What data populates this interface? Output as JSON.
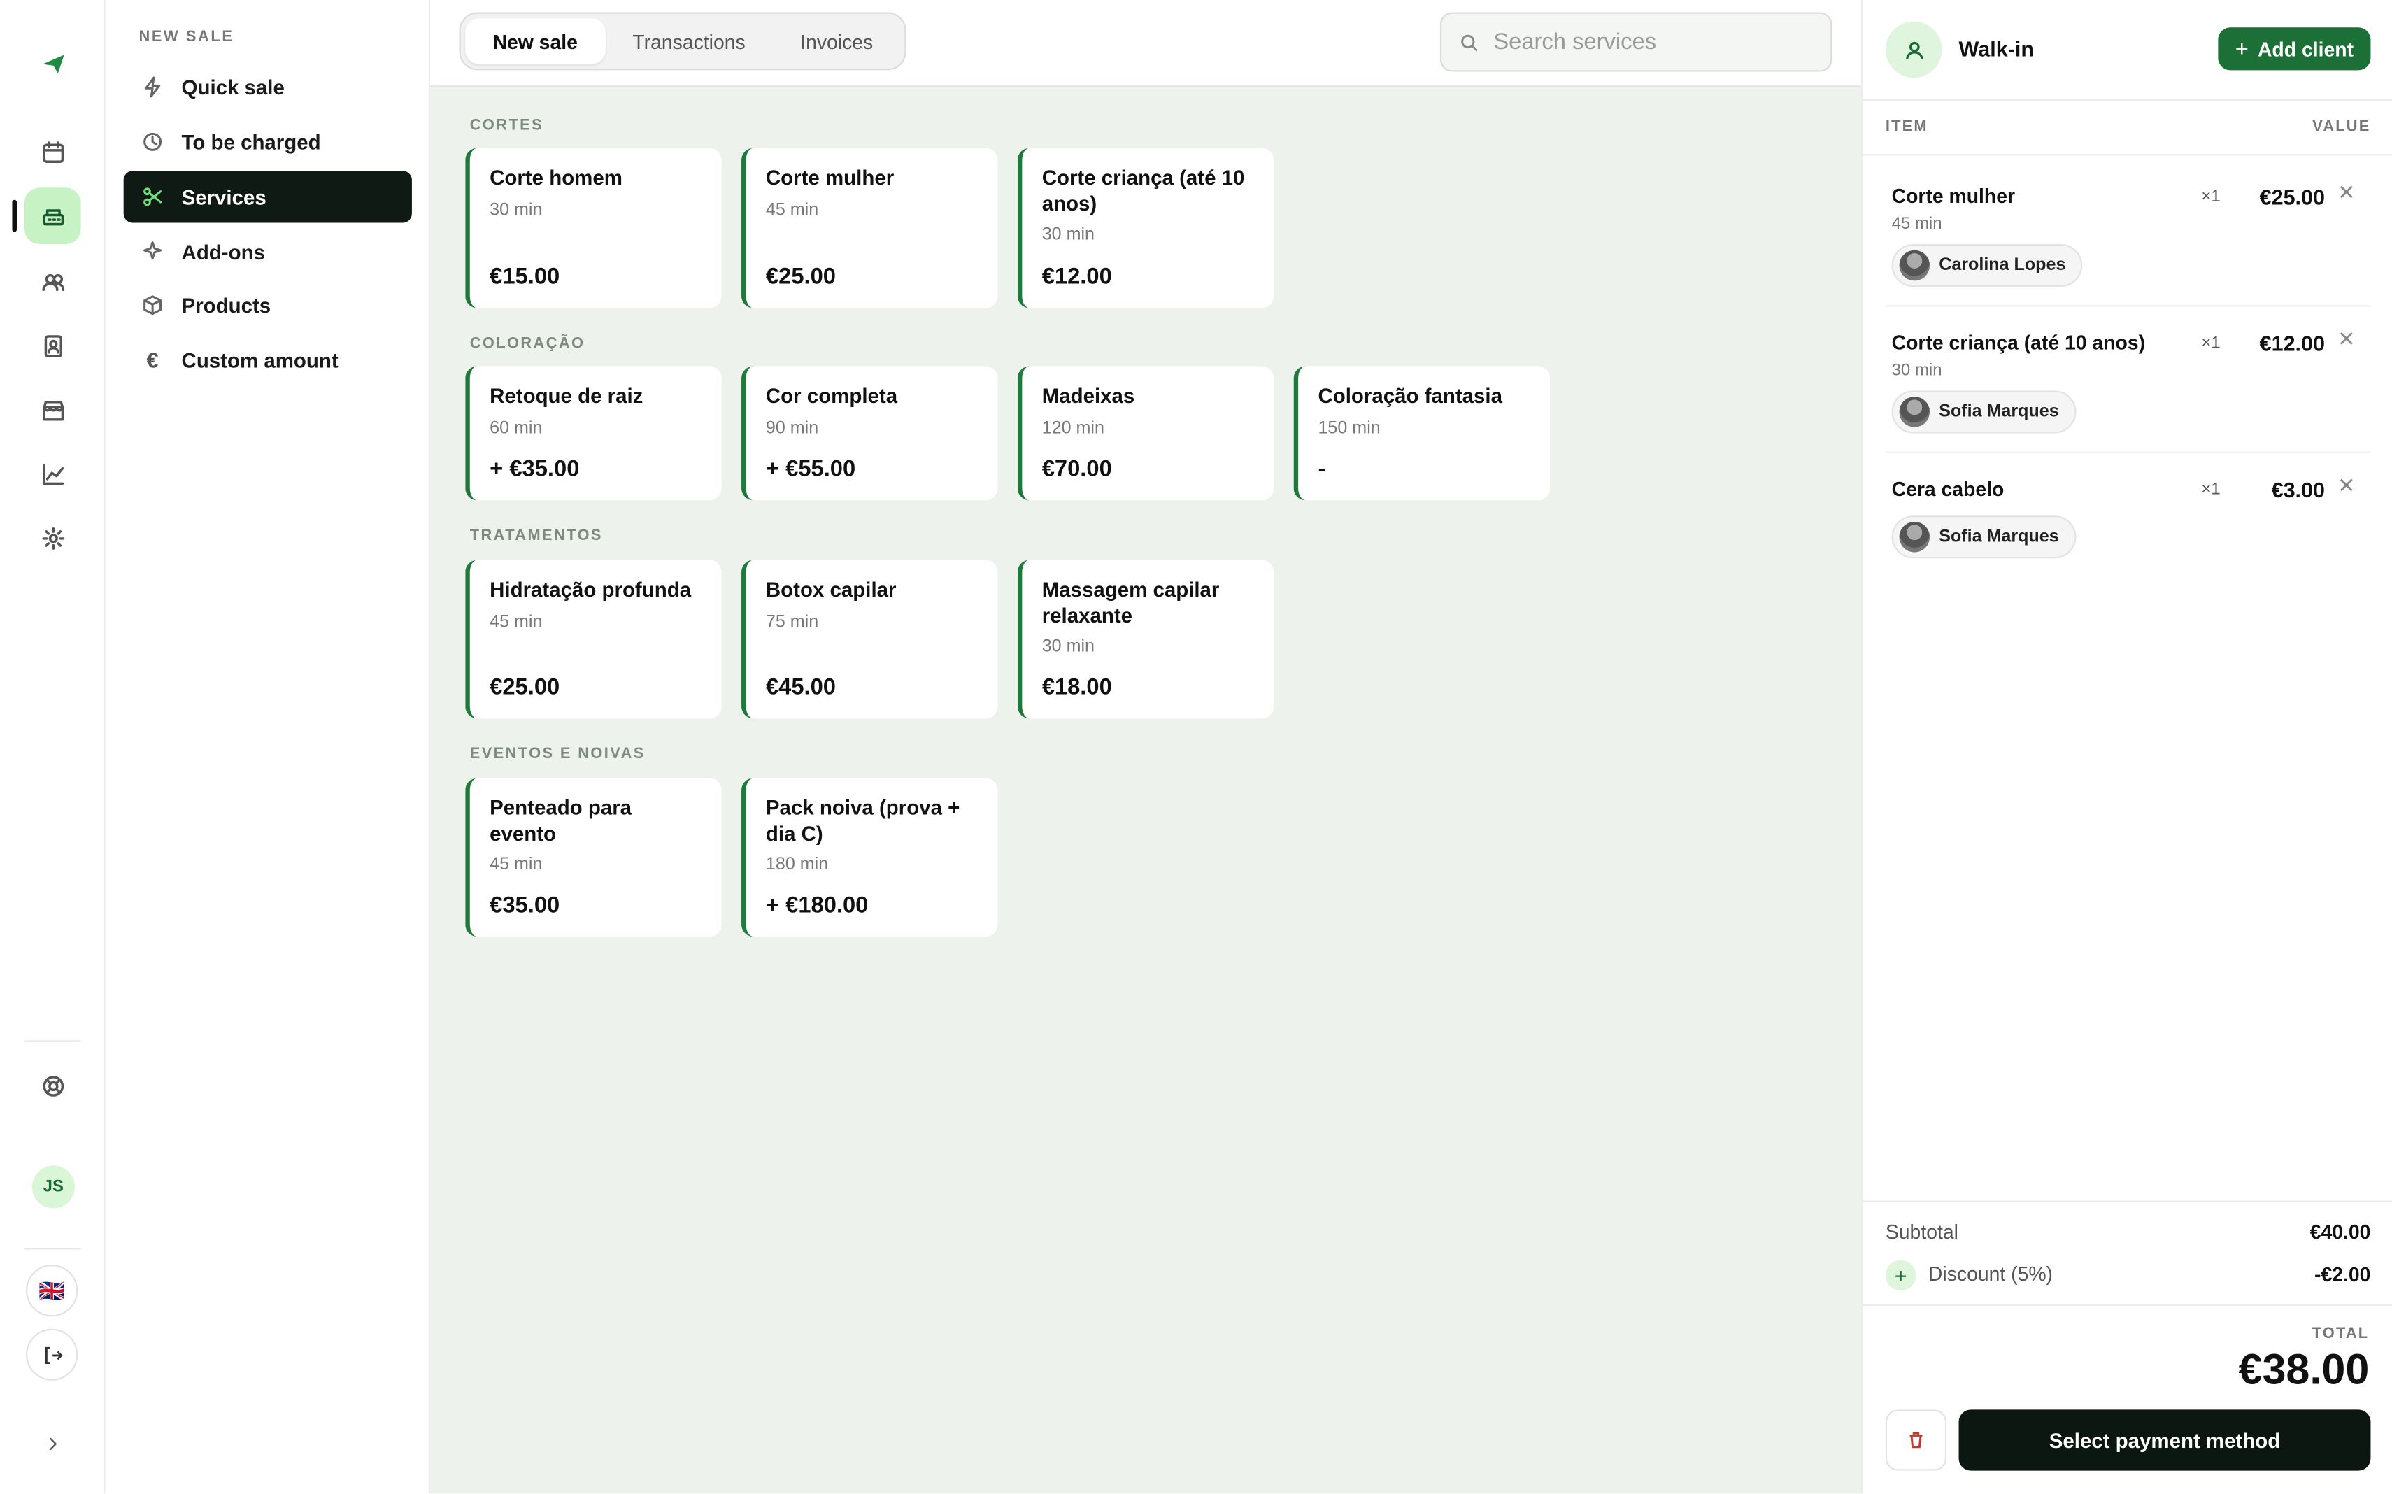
{
  "colors": {
    "accent": "#1d6f38",
    "accent_light": "#c6f2c4",
    "dark": "#0f1a14",
    "main_bg": "#edf3ec"
  },
  "rail": {
    "icons": [
      "logo-icon",
      "calendar-icon",
      "register-icon",
      "clients-icon",
      "staff-icon",
      "store-icon",
      "reports-icon",
      "settings-icon",
      "help-icon"
    ],
    "user_initials": "JS",
    "language_flag": "🇬🇧"
  },
  "submenu": {
    "heading": "NEW SALE",
    "items": [
      {
        "label": "Quick sale",
        "icon": "lightning-icon"
      },
      {
        "label": "To be charged",
        "icon": "clock-icon"
      },
      {
        "label": "Services",
        "icon": "scissors-icon"
      },
      {
        "label": "Add-ons",
        "icon": "sparkle-icon"
      },
      {
        "label": "Products",
        "icon": "box-icon"
      },
      {
        "label": "Custom amount",
        "icon": "euro-icon"
      }
    ],
    "active": "Services"
  },
  "topbar": {
    "tabs": [
      "New sale",
      "Transactions",
      "Invoices"
    ],
    "active_tab": "New sale",
    "search_placeholder": "Search services"
  },
  "sections": [
    {
      "title": "CORTES",
      "services": [
        {
          "name": "Corte homem",
          "duration": "30 min",
          "price": "€15.00"
        },
        {
          "name": "Corte mulher",
          "duration": "45 min",
          "price": "€25.00"
        },
        {
          "name": "Corte criança (até 10 anos)",
          "duration": "30 min",
          "price": "€12.00"
        }
      ]
    },
    {
      "title": "COLORAÇÃO",
      "services": [
        {
          "name": "Retoque de raiz",
          "duration": "60 min",
          "price": "+ €35.00"
        },
        {
          "name": "Cor completa",
          "duration": "90 min",
          "price": "+ €55.00"
        },
        {
          "name": "Madeixas",
          "duration": "120 min",
          "price": "€70.00"
        },
        {
          "name": "Coloração fantasia",
          "duration": "150 min",
          "price": "-"
        }
      ]
    },
    {
      "title": "TRATAMENTOS",
      "services": [
        {
          "name": "Hidratação profunda",
          "duration": "45 min",
          "price": "€25.00"
        },
        {
          "name": "Botox capilar",
          "duration": "75 min",
          "price": "€45.00"
        },
        {
          "name": "Massagem capilar relaxante",
          "duration": "30 min",
          "price": "€18.00"
        }
      ]
    },
    {
      "title": "EVENTOS E NOIVAS",
      "services": [
        {
          "name": "Penteado para evento",
          "duration": "45 min",
          "price": "€35.00"
        },
        {
          "name": "Pack noiva (prova + dia C)",
          "duration": "180 min",
          "price": "+ €180.00"
        }
      ]
    }
  ],
  "cart": {
    "client_name": "Walk-in",
    "add_client_label": "Add client",
    "col_item": "ITEM",
    "col_value": "VALUE",
    "lines": [
      {
        "name": "Corte mulher",
        "duration": "45 min",
        "qty": "×1",
        "price": "€25.00",
        "staff": "Carolina Lopes"
      },
      {
        "name": "Corte criança (até 10 anos)",
        "duration": "30 min",
        "qty": "×1",
        "price": "€12.00",
        "staff": "Sofia Marques"
      },
      {
        "name": "Cera cabelo",
        "duration": "",
        "qty": "×1",
        "price": "€3.00",
        "staff": "Sofia Marques"
      }
    ],
    "subtotal_label": "Subtotal",
    "subtotal_value": "€40.00",
    "discount_label": "Discount (5%)",
    "discount_value": "-€2.00",
    "total_label": "TOTAL",
    "total_value": "€38.00",
    "pay_label": "Select payment method"
  }
}
